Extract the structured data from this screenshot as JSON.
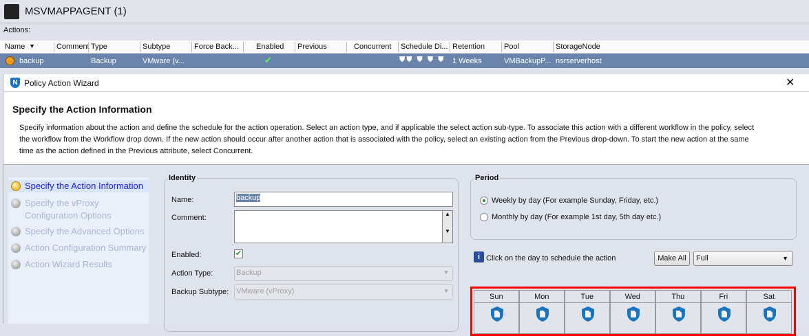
{
  "top": {
    "title": "MSVMAPPAGENT (1)",
    "actions_label": "Actions:"
  },
  "table": {
    "columns": [
      "Name",
      "Comment",
      "Type",
      "Subtype",
      "Force Back...",
      "Enabled",
      "Previous",
      "Concurrent",
      "Schedule Di...",
      "Retention",
      "Pool",
      "StorageNode"
    ],
    "rows": [
      {
        "name": "backup",
        "comment": "",
        "type": "Backup",
        "subtype": "VMware (v...",
        "enabled": true,
        "retention": "1 Weeks",
        "pool": "VMBackupP...",
        "storage_node": "nsrserverhost"
      }
    ]
  },
  "wizard": {
    "title": "Policy Action Wizard",
    "heading": "Specify the Action Information",
    "description": "Specify information about the action and define the schedule for the action operation. Select an action type, and if applicable the select action sub-type. To associate this action with a different workflow in the policy, select the workflow from the Workflow drop down. If the new action should occur after another action that is associated with the policy, select an existing action from the Previous drop-down. To start the new action at the same time as the action defined in the Previous attribute, select Concurrent.",
    "steps": [
      "Specify the Action Information",
      "Specify the vProxy Configuration Options",
      "Specify the Advanced Options",
      "Action Configuration Summary",
      "Action Wizard Results"
    ]
  },
  "identity": {
    "legend": "Identity",
    "name_label": "Name:",
    "name_value": "backup",
    "comment_label": "Comment:",
    "comment_value": "",
    "enabled_label": "Enabled:",
    "enabled": true,
    "action_type_label": "Action Type:",
    "action_type_value": "Backup",
    "subtype_label": "Backup Subtype:",
    "subtype_value": "VMware (vProxy)"
  },
  "period": {
    "legend": "Period",
    "weekly": "Weekly by day  (For example Sunday, Friday, etc.)",
    "monthly": "Monthly by day (For example 1st day, 5th day etc.)",
    "selected": "weekly",
    "info": "Click on the day to schedule the action",
    "make_all": "Make All",
    "level": "Full",
    "days": [
      "Sun",
      "Mon",
      "Tue",
      "Wed",
      "Thu",
      "Fri",
      "Sat"
    ]
  },
  "colors": {
    "selected_row": "#6a84ab",
    "highlight": "#ff0000",
    "shield": "#1a74c0"
  }
}
